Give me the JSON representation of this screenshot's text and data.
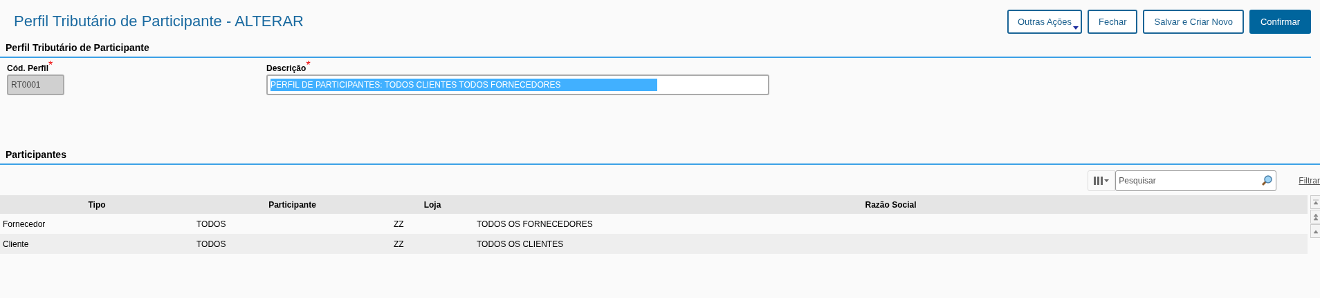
{
  "header": {
    "title": "Perfil Tributário de Participante - ALTERAR",
    "buttons": [
      {
        "label": "Outras Ações",
        "kind": "menu"
      },
      {
        "label": "Fechar",
        "kind": "outline"
      },
      {
        "label": "Salvar e Criar Novo",
        "kind": "outline"
      },
      {
        "label": "Confirmar",
        "kind": "primary"
      }
    ]
  },
  "profile_section": {
    "title": "Perfil Tributário de Participante",
    "fields": [
      {
        "label": "Cód. Perfil",
        "required_mark": "*",
        "value": "RT0001",
        "disabled": true,
        "text_selected": false
      },
      {
        "label": "Descrição",
        "required_mark": "*",
        "value": "PERFIL DE PARTICIPANTES: TODOS CLIENTES TODOS FORNECEDORES",
        "disabled": false,
        "text_selected": true
      }
    ]
  },
  "participants_section": {
    "title": "Participantes",
    "search": {
      "placeholder": "Pesquisar"
    },
    "filter_link": "Filtrar",
    "table": {
      "columns": [
        "Tipo",
        "Participante",
        "Loja",
        "Razão Social"
      ],
      "rows": [
        [
          "Fornecedor",
          "TODOS",
          "ZZ",
          "TODOS OS FORNECEDORES"
        ],
        [
          "Cliente",
          "TODOS",
          "ZZ",
          "TODOS OS CLIENTES"
        ]
      ]
    }
  }
}
